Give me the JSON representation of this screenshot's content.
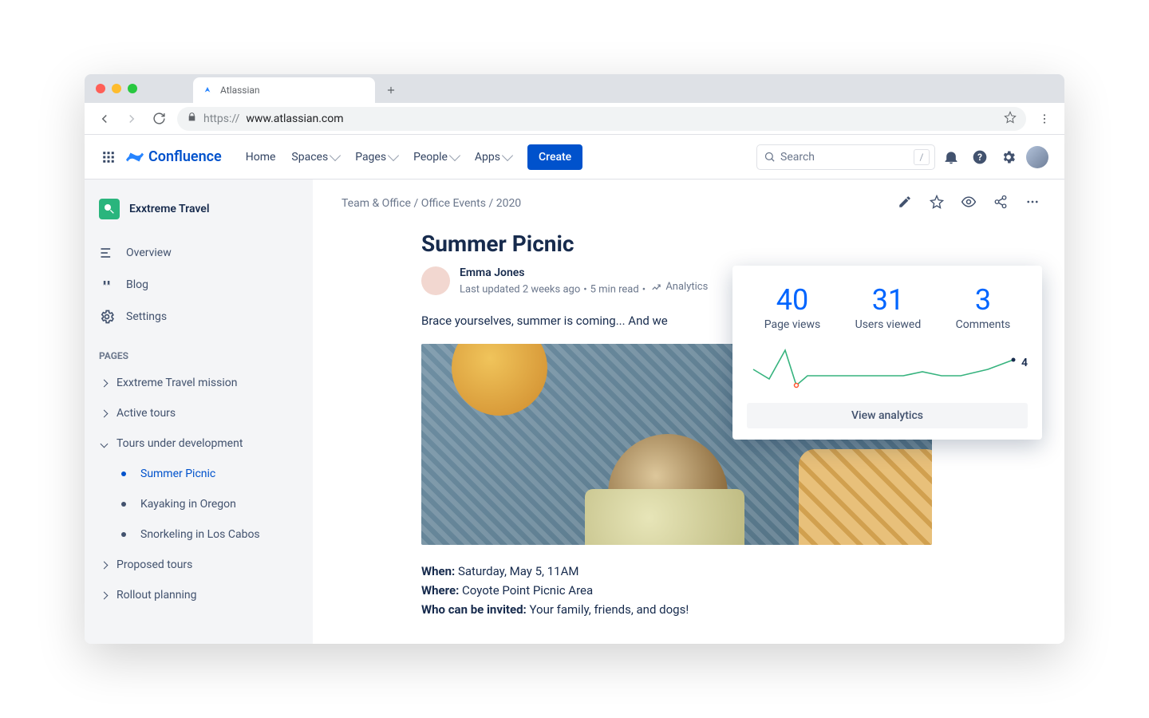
{
  "browser": {
    "tab_title": "Atlassian",
    "url_proto": "https://",
    "url_host": "www.atlassian.com"
  },
  "header": {
    "product": "Confluence",
    "nav": {
      "home": "Home",
      "spaces": "Spaces",
      "pages": "Pages",
      "people": "People",
      "apps": "Apps"
    },
    "create": "Create",
    "search_placeholder": "Search",
    "search_key": "/"
  },
  "sidebar": {
    "space_name": "Exxtreme Travel",
    "overview": "Overview",
    "blog": "Blog",
    "settings": "Settings",
    "pages_heading": "PAGES",
    "tree": {
      "mission": "Exxtreme Travel mission",
      "active_tours": "Active tours",
      "tours_dev": "Tours under development",
      "summer_picnic": "Summer Picnic",
      "kayaking": "Kayaking in Oregon",
      "snorkeling": "Snorkeling in Los Cabos",
      "proposed": "Proposed tours",
      "rollout": "Rollout planning"
    }
  },
  "page": {
    "breadcrumb": {
      "a": "Team & Office",
      "b": "Office Events",
      "c": "2020"
    },
    "title": "Summer Picnic",
    "author": "Emma Jones",
    "meta_updated": "Last updated 2 weeks ago",
    "meta_read": "5 min read",
    "meta_analytics": "Analytics",
    "intro": "Brace yourselves, summer is coming... And we",
    "when_label": "When:",
    "when_val": " Saturday, May 5, 11AM",
    "where_label": "Where:",
    "where_val": " Coyote Point Picnic Area",
    "who_label": "Who can be invited:",
    "who_val": " Your family, friends, and dogs!"
  },
  "analytics": {
    "page_views": "40",
    "page_views_label": "Page views",
    "users": "31",
    "users_label": "Users viewed",
    "comments": "3",
    "comments_label": "Comments",
    "spark_label": "4",
    "button": "View analytics"
  },
  "chart_data": {
    "type": "line",
    "title": "Page views sparkline",
    "x": [
      0,
      1,
      2,
      3,
      4,
      5,
      6,
      7,
      8,
      9,
      10,
      11,
      12,
      13,
      14,
      15
    ],
    "values": [
      5,
      2,
      16,
      4,
      3,
      4,
      4,
      4,
      4,
      4,
      4,
      5,
      4,
      4,
      6,
      9
    ],
    "current_label": 4,
    "ylim": [
      0,
      16
    ]
  }
}
